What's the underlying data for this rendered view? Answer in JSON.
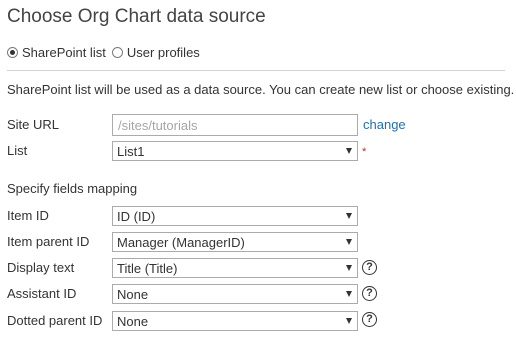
{
  "page": {
    "title": "Choose Org Chart data source"
  },
  "data_source": {
    "options": [
      {
        "label": "SharePoint list",
        "selected": true
      },
      {
        "label": "User profiles",
        "selected": false
      }
    ],
    "description": "SharePoint list will be used as a data source. You can create new list or choose existing."
  },
  "site_url": {
    "label": "Site URL",
    "placeholder": "/sites/tutorials",
    "value": "",
    "change_link": "change"
  },
  "list": {
    "label": "List",
    "value": "List1",
    "required_marker": "*"
  },
  "fields_mapping": {
    "heading": "Specify fields mapping",
    "rows": [
      {
        "label": "Item ID",
        "value": "ID (ID)",
        "help": false
      },
      {
        "label": "Item parent ID",
        "value": "Manager (ManagerID)",
        "help": false
      },
      {
        "label": "Display text",
        "value": "Title (Title)",
        "help": true
      },
      {
        "label": "Assistant ID",
        "value": "None",
        "help": true
      },
      {
        "label": "Dotted parent ID",
        "value": "None",
        "help": true
      }
    ],
    "help_glyph": "?"
  },
  "colors": {
    "link": "#1e6fb5",
    "required": "#c62828",
    "border": "#ababab",
    "divider": "#d4d4d4",
    "text": "#333333"
  },
  "icons": {
    "select_arrow": "triangle-down",
    "help": "question-circle",
    "radio": "radio-button"
  }
}
